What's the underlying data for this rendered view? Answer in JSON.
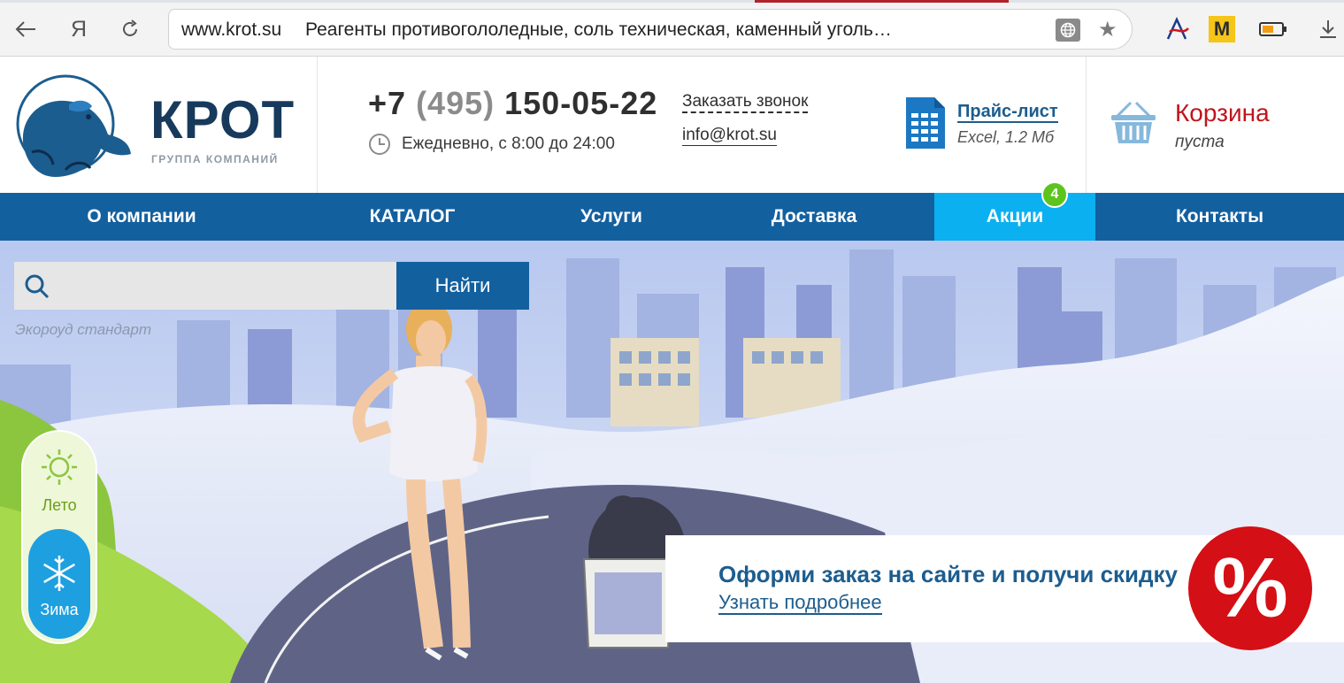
{
  "browser": {
    "domain": "www.krot.su",
    "page_title": "Реагенты противогололедные, соль техническая, каменный уголь…",
    "back_icon": "arrow-left-icon",
    "yandex_icon": "yandex-logo-icon",
    "reload_icon": "reload-icon",
    "translate_icon": "globe-icon",
    "bookmark_icon": "star-icon",
    "ext_m_label": "M",
    "download_icon": "download-icon"
  },
  "header": {
    "logo_title": "КРОТ",
    "logo_subtitle": "ГРУППА КОМПАНИЙ",
    "phone_prefix": "+7",
    "phone_code": "(495)",
    "phone_number": "150-05-22",
    "callback_label": "Заказать звонок",
    "hours": "Ежедневно, с 8:00 до 24:00",
    "email": "info@krot.su",
    "price_list_label": "Прайс-лист",
    "price_list_meta": "Excel, 1.2 Мб",
    "cart_label": "Корзина",
    "cart_status": "пуста"
  },
  "nav": {
    "items": [
      {
        "label": "О компании"
      },
      {
        "label": "КАТАЛОГ"
      },
      {
        "label": "Услуги"
      },
      {
        "label": "Доставка"
      },
      {
        "label": "Акции"
      },
      {
        "label": "Контакты"
      }
    ],
    "promo_count": "4"
  },
  "search": {
    "button_label": "Найти",
    "hint": "Экороуд стандарт"
  },
  "season": {
    "summer_label": "Лето",
    "winter_label": "Зима"
  },
  "promo": {
    "title": "Оформи заказ на сайте и получи скидку",
    "link_label": "Узнать подробнее",
    "badge_symbol": "%"
  },
  "colors": {
    "nav_bg": "#13609f",
    "nav_active": "#0bb0f0",
    "brand_dark": "#173a5c",
    "cart_red": "#c0151b",
    "badge_green": "#5dc41d",
    "promo_red": "#d40f15"
  }
}
